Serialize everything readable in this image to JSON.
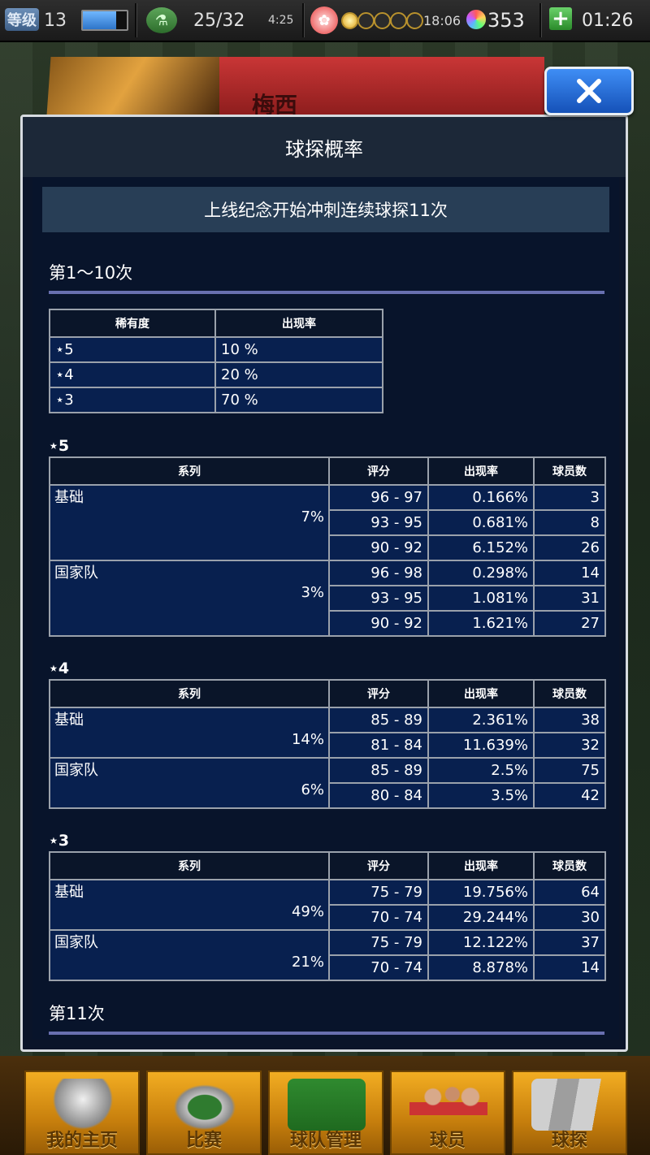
{
  "status_bar": {
    "level_label": "等级",
    "level": "13",
    "exp_fill": 0.75,
    "stamina": "25/32",
    "stamina_timer": "4:25",
    "coins_total": 5,
    "coins_filled": 1,
    "coin_timer": "18:06",
    "gems": "353",
    "clock": "01:26"
  },
  "background": {
    "player_name": "梅西"
  },
  "close_button": {
    "icon": "close-icon"
  },
  "modal": {
    "title": "球探概率",
    "event_title": "上线纪念开始冲刺连续球探11次",
    "section1_title": "第1～10次",
    "section2_title": "第11次",
    "rarity_table": {
      "headers": [
        "稀有度",
        "出现率"
      ],
      "rows": [
        {
          "rarity": "⋆5",
          "rate": "10 %"
        },
        {
          "rarity": "⋆4",
          "rate": "20 %"
        },
        {
          "rarity": "⋆3",
          "rate": "70 %"
        }
      ]
    },
    "detail_headers": [
      "系列",
      "评分",
      "出现率",
      "球员数"
    ],
    "star5": {
      "title": "⋆5",
      "groups": [
        {
          "series": "基础",
          "pct": "7%",
          "rows": [
            {
              "rating": "96 - 97",
              "rate": "0.166%",
              "count": "3"
            },
            {
              "rating": "93 - 95",
              "rate": "0.681%",
              "count": "8"
            },
            {
              "rating": "90 - 92",
              "rate": "6.152%",
              "count": "26"
            }
          ]
        },
        {
          "series": "国家队",
          "pct": "3%",
          "rows": [
            {
              "rating": "96 - 98",
              "rate": "0.298%",
              "count": "14"
            },
            {
              "rating": "93 - 95",
              "rate": "1.081%",
              "count": "31"
            },
            {
              "rating": "90 - 92",
              "rate": "1.621%",
              "count": "27"
            }
          ]
        }
      ]
    },
    "star4": {
      "title": "⋆4",
      "groups": [
        {
          "series": "基础",
          "pct": "14%",
          "rows": [
            {
              "rating": "85 - 89",
              "rate": "2.361%",
              "count": "38"
            },
            {
              "rating": "81 - 84",
              "rate": "11.639%",
              "count": "32"
            }
          ]
        },
        {
          "series": "国家队",
          "pct": "6%",
          "rows": [
            {
              "rating": "85 - 89",
              "rate": "2.5%",
              "count": "75"
            },
            {
              "rating": "80 - 84",
              "rate": "3.5%",
              "count": "42"
            }
          ]
        }
      ]
    },
    "star3": {
      "title": "⋆3",
      "groups": [
        {
          "series": "基础",
          "pct": "49%",
          "rows": [
            {
              "rating": "75 - 79",
              "rate": "19.756%",
              "count": "64"
            },
            {
              "rating": "70 - 74",
              "rate": "29.244%",
              "count": "30"
            }
          ]
        },
        {
          "series": "国家队",
          "pct": "21%",
          "rows": [
            {
              "rating": "75 - 79",
              "rate": "12.122%",
              "count": "37"
            },
            {
              "rating": "70 - 74",
              "rate": "8.878%",
              "count": "14"
            }
          ]
        }
      ]
    }
  },
  "nav": [
    {
      "label": "我的主页",
      "icon": "club-crest-icon"
    },
    {
      "label": "比赛",
      "icon": "stadium-icon"
    },
    {
      "label": "球队管理",
      "icon": "formation-icon"
    },
    {
      "label": "球员",
      "icon": "players-icon"
    },
    {
      "label": "球探",
      "icon": "scout-cards-icon"
    }
  ],
  "colors": {
    "modal_bg": "#08142b",
    "cell_bg": "#08204f",
    "header_bg": "#1c2838",
    "accent_line": "#6870b0",
    "nav_gold": "#f2ad22",
    "close_blue": "#1551b8"
  }
}
